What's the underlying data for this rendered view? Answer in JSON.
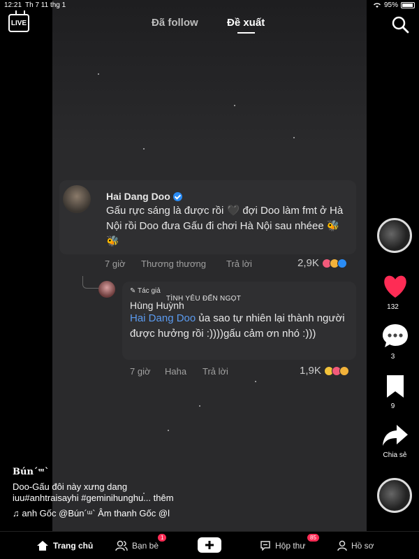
{
  "status": {
    "time": "12:21",
    "date": "Th 7 11 thg 1",
    "battery": "95%"
  },
  "tabs": {
    "following": "Đã follow",
    "for_you": "Đề xuất"
  },
  "live_label": "LIVE",
  "comment": {
    "author": "Hai Dang Doo",
    "text": "Gấu rực sáng là được rồi 🖤 đợi Doo làm fmt ở Hà Nội rồi Doo đưa Gấu đi chơi Hà Nội sau nhéee 🐝🐝",
    "time": "7 giờ",
    "reaction": "Thương thương",
    "reply_label": "Trả lời",
    "likes": "2,9K"
  },
  "reply": {
    "author_tag": "Tác giả",
    "overlay_title": "TÌNH YÊU ĐẾN NGỌT",
    "author": "Hùng Huỳnh",
    "mention": "Hai Dang Doo",
    "text": " ủa sao tự nhiên lại thành người được hưởng rồi :))))gấu cảm ơn nhó :)))",
    "time": "7 giờ",
    "reaction": "Haha",
    "reply_label": "Trả lời",
    "likes": "1,9K"
  },
  "side": {
    "likes": "132",
    "comments": "3",
    "saves": "9",
    "share_label": "Chia sẻ"
  },
  "caption": {
    "username": "Bún´ᵚ`",
    "line1": "Doo-Gấu đôi này xưng dang",
    "line2": "iuu#anhtraisayhi #geminihunghu... thêm",
    "music": "♫ anh Gốc    @Bún´ᵚ` Âm thanh Gốc    @l"
  },
  "nav": {
    "home": "Trang chủ",
    "friends": "Bạn bè",
    "friends_badge": "1",
    "inbox": "Hộp thư",
    "inbox_badge": "85",
    "profile": "Hồ sơ"
  },
  "colors": {
    "accent": "#fe2c55",
    "mention": "#5b9bf0",
    "reaction": "#e3a84f"
  }
}
